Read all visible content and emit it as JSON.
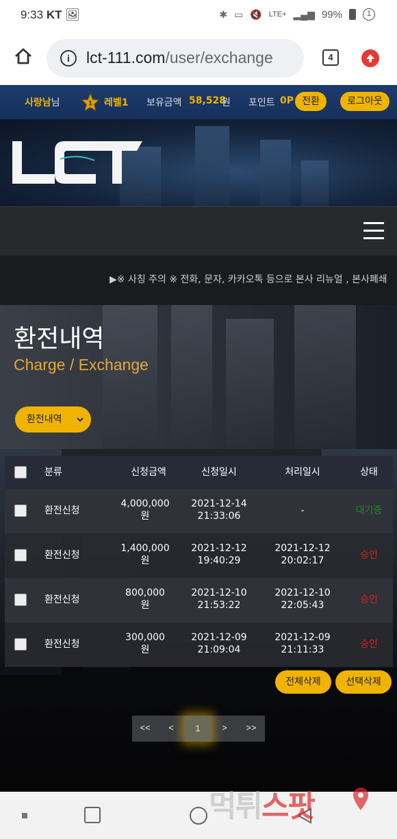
{
  "statusbar": {
    "time": "9:33",
    "carrier": "KT",
    "battery": "99%",
    "network": "LTE+",
    "notification_count": "1"
  },
  "browser": {
    "url_host": "lct-111.com",
    "url_path": "/user/exchange",
    "tab_count": "4"
  },
  "topbar": {
    "username": "사랑남",
    "username_suffix": "님",
    "level_badge": "1",
    "level": "레벨1",
    "balance_label": "보유금액",
    "balance": "58,528",
    "balance_unit": "원",
    "point_label": "포인트",
    "point": "0P",
    "convert_button": "전환",
    "logout_button": "로그아웃"
  },
  "ticker": {
    "text": "▶※ 사칭 주의 ※ 전화, 문자, 카카오톡 등으로 본사 리뉴얼 , 본사폐쇄"
  },
  "hero": {
    "title": "환전내역",
    "subtitle": "Charge / Exchange",
    "dropdown_label": "환전내역"
  },
  "table": {
    "headers": [
      "분류",
      "신청금액",
      "신청일시",
      "처리일시",
      "상태"
    ],
    "rows": [
      {
        "type": "환전신청",
        "amount": "4,000,000",
        "unit": "원",
        "req_date": "2021-12-14",
        "req_time": "21:33:06",
        "proc_date": "-",
        "proc_time": "",
        "status": "대기중",
        "status_kind": "wait"
      },
      {
        "type": "환전신청",
        "amount": "1,400,000",
        "unit": "원",
        "req_date": "2021-12-12",
        "req_time": "19:40:29",
        "proc_date": "2021-12-12",
        "proc_time": "20:02:17",
        "status": "승인",
        "status_kind": "ok"
      },
      {
        "type": "환전신청",
        "amount": "800,000",
        "unit": "원",
        "req_date": "2021-12-10",
        "req_time": "21:53:22",
        "proc_date": "2021-12-10",
        "proc_time": "22:05:43",
        "status": "승인",
        "status_kind": "ok"
      },
      {
        "type": "환전신청",
        "amount": "300,000",
        "unit": "원",
        "req_date": "2021-12-09",
        "req_time": "21:09:04",
        "proc_date": "2021-12-09",
        "proc_time": "21:11:33",
        "status": "승인",
        "status_kind": "ok"
      }
    ]
  },
  "actions": {
    "delete_all": "전체삭제",
    "delete_selected": "선택삭제"
  },
  "pager": {
    "first": "<<",
    "prev": "<",
    "current": "1",
    "next": ">",
    "last": ">>"
  },
  "watermark": {
    "text_a": "먹튀",
    "text_b": "스팟"
  },
  "colors": {
    "accent": "#f0b400",
    "status_wait": "#1f8a1f",
    "status_ok": "#d02020"
  }
}
